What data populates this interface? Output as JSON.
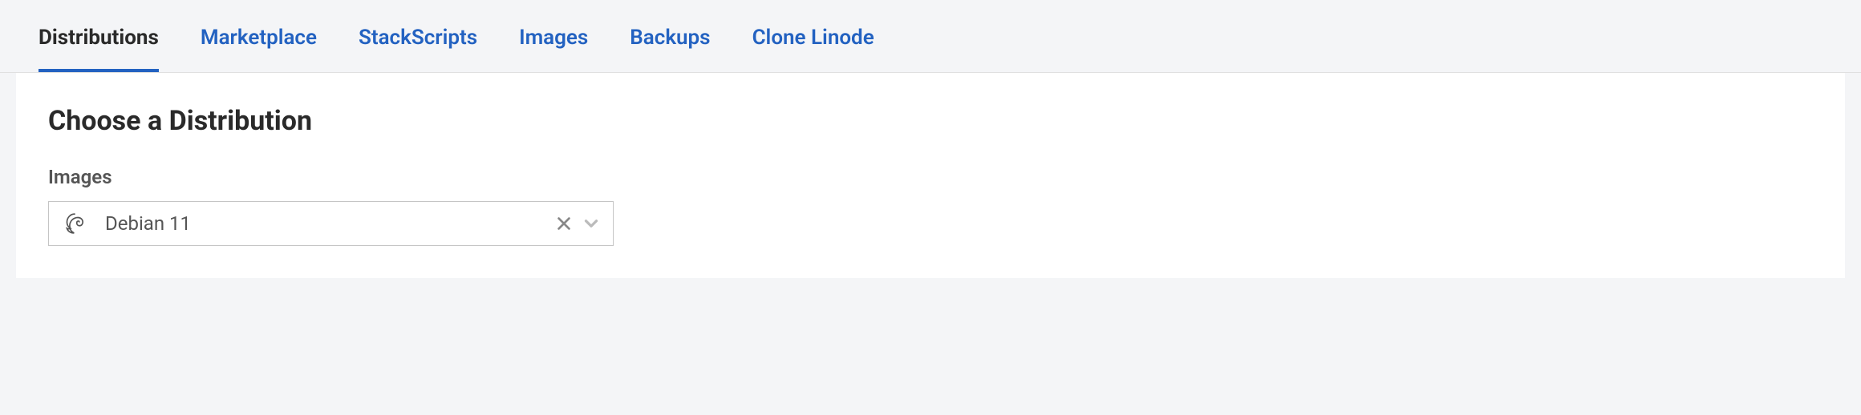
{
  "tabs": {
    "distributions": "Distributions",
    "marketplace": "Marketplace",
    "stackscripts": "StackScripts",
    "images": "Images",
    "backups": "Backups",
    "clone": "Clone Linode"
  },
  "section": {
    "title": "Choose a Distribution"
  },
  "imagesField": {
    "label": "Images",
    "selected": "Debian 11"
  }
}
